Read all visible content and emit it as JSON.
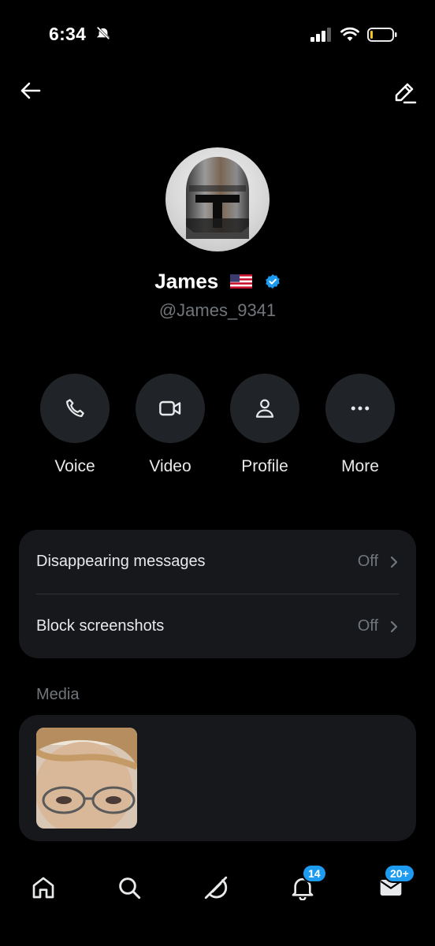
{
  "status_bar": {
    "time": "6:34",
    "icons": [
      "bell-slash-icon",
      "cell-signal-icon",
      "wifi-icon",
      "battery-icon"
    ]
  },
  "header": {
    "back_icon": "arrow-left-icon",
    "edit_icon": "edit-icon"
  },
  "profile": {
    "name": "James",
    "flag": "🇺🇸",
    "verified": true,
    "handle": "@James_9341",
    "avatar": "helmet-avatar"
  },
  "actions": [
    {
      "label": "Voice",
      "icon": "phone-icon"
    },
    {
      "label": "Video",
      "icon": "video-camera-icon"
    },
    {
      "label": "Profile",
      "icon": "person-icon"
    },
    {
      "label": "More",
      "icon": "more-dots-icon"
    }
  ],
  "settings": [
    {
      "label": "Disappearing messages",
      "value": "Off"
    },
    {
      "label": "Block screenshots",
      "value": "Off"
    }
  ],
  "media": {
    "title": "Media",
    "items": [
      "photo-thumbnail"
    ]
  },
  "tabbar": {
    "tabs": [
      {
        "name": "home",
        "icon": "home-icon",
        "badge": ""
      },
      {
        "name": "search",
        "icon": "search-icon",
        "badge": ""
      },
      {
        "name": "grok",
        "icon": "grok-icon",
        "badge": ""
      },
      {
        "name": "notifications",
        "icon": "bell-icon",
        "badge": "14"
      },
      {
        "name": "messages",
        "icon": "envelope-icon",
        "badge": "20+"
      }
    ]
  },
  "colors": {
    "background": "#000000",
    "card": "#16181c",
    "button_circle": "#202327",
    "muted": "#71767b",
    "accent": "#1d9bf0"
  }
}
